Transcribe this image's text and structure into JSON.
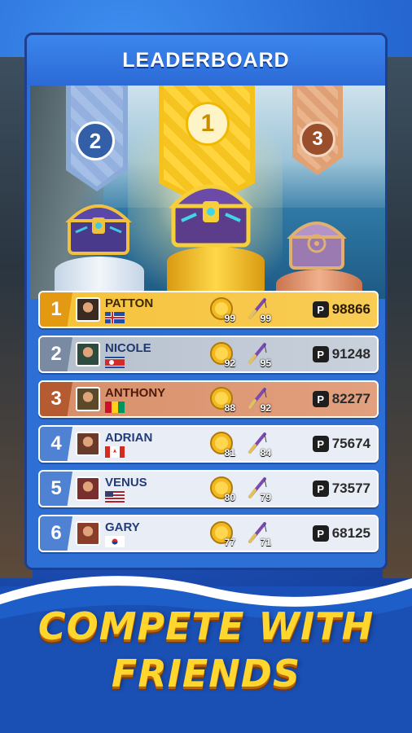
{
  "header": {
    "title": "LEADERBOARD"
  },
  "podium": [
    {
      "rank": "1",
      "color": "#f4c21a"
    },
    {
      "rank": "2",
      "color": "#8aaad8"
    },
    {
      "rank": "3",
      "color": "#e2a173"
    }
  ],
  "players": [
    {
      "rank": "1",
      "name": "PATTON",
      "flag": "iceland",
      "coins": "99",
      "rods": "99",
      "score": "98866",
      "tier": "gold"
    },
    {
      "rank": "2",
      "name": "NICOLE",
      "flag": "north-korea",
      "coins": "92",
      "rods": "95",
      "score": "91248",
      "tier": "silver"
    },
    {
      "rank": "3",
      "name": "ANTHONY",
      "flag": "guinea",
      "coins": "88",
      "rods": "92",
      "score": "82277",
      "tier": "bronze"
    },
    {
      "rank": "4",
      "name": "ADRIAN",
      "flag": "canada",
      "coins": "81",
      "rods": "84",
      "score": "75674",
      "tier": "plain"
    },
    {
      "rank": "5",
      "name": "VENUS",
      "flag": "usa",
      "coins": "80",
      "rods": "79",
      "score": "73577",
      "tier": "plain"
    },
    {
      "rank": "6",
      "name": "GARY",
      "flag": "south-korea",
      "coins": "77",
      "rods": "71",
      "score": "68125",
      "tier": "plain"
    }
  ],
  "score_icon": "P",
  "promo": {
    "line1": "COMPETE WITH",
    "line2": "FRIENDS"
  },
  "colors": {
    "panel": "#2e6fd6",
    "promo_text": "#ffd62e",
    "gold": "#f6c23a",
    "silver": "#b5bfcc",
    "bronze": "#d78f6a"
  }
}
